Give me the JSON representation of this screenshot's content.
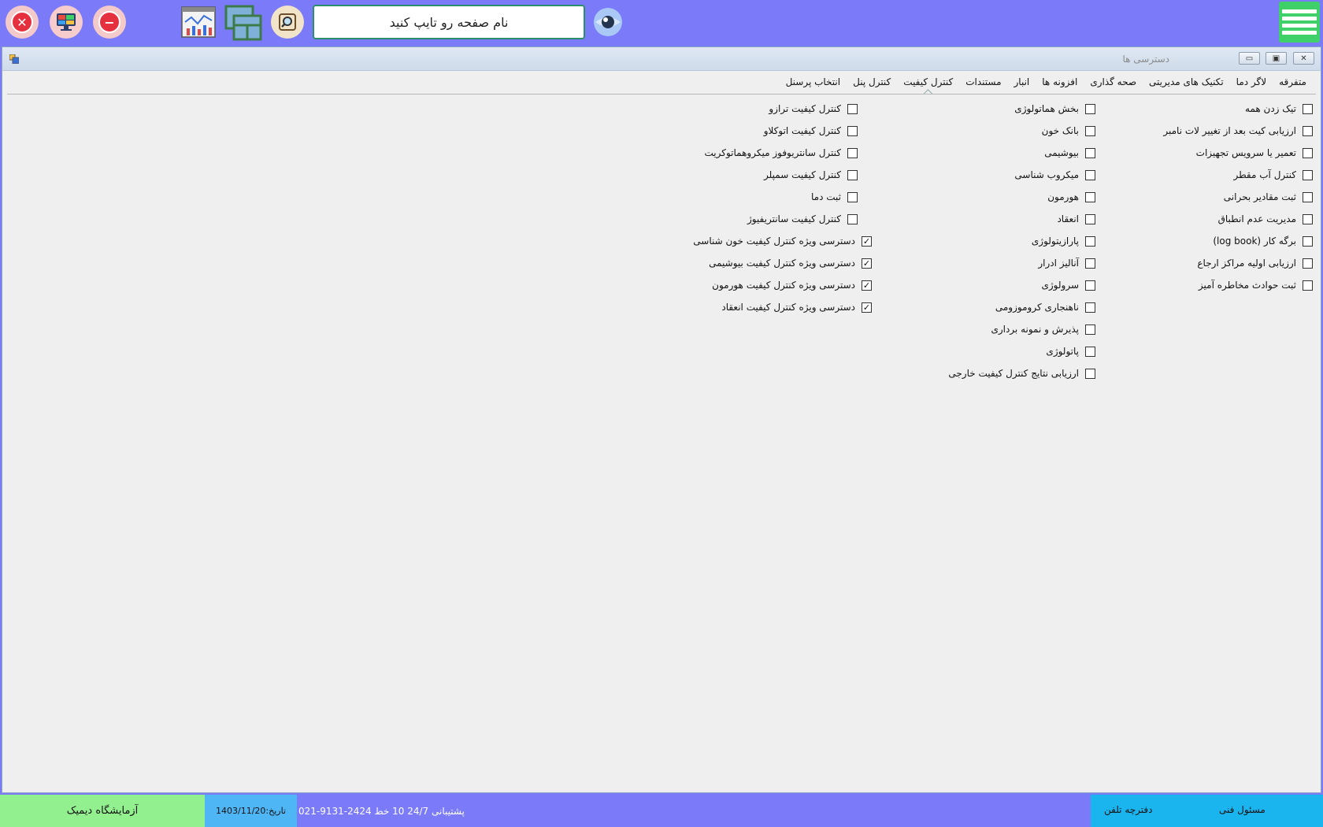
{
  "topbar": {
    "search_placeholder": "نام صفحه رو تایپ کنید"
  },
  "window": {
    "title": "دسترسی ها",
    "min_label": "▭",
    "max_label": "▣",
    "close_label": "✕"
  },
  "tabs": [
    {
      "label": "انتخاب پرسنل"
    },
    {
      "label": "کنترل پنل"
    },
    {
      "label": "کنترل کیفیت",
      "active": true
    },
    {
      "label": "مستندات"
    },
    {
      "label": "انبار"
    },
    {
      "label": "افزونه ها"
    },
    {
      "label": "صحه گذاری"
    },
    {
      "label": "تکنیک های مدیریتی"
    },
    {
      "label": "لاگر دما"
    },
    {
      "label": "متفرقه"
    }
  ],
  "columns": {
    "col1": [
      {
        "label": "تیک زدن همه",
        "checked": false
      },
      {
        "label": "ارزیابی کیت بعد از تغییر لات نامبر",
        "checked": false
      },
      {
        "label": "تعمیر یا سرویس تجهیزات",
        "checked": false
      },
      {
        "label": "کنترل آب مقطر",
        "checked": false
      },
      {
        "label": "ثبت مقادیر بحرانی",
        "checked": false
      },
      {
        "label": "مدیریت عدم انطباق",
        "checked": false
      },
      {
        "label": "برگه کار (log book)",
        "checked": false
      },
      {
        "label": "ارزیابی اولیه مراکز ارجاع",
        "checked": false
      },
      {
        "label": "ثبت حوادث مخاطره آمیز",
        "checked": false
      }
    ],
    "col2": [
      {
        "label": "بخش هماتولوژی",
        "checked": false
      },
      {
        "label": "بانک خون",
        "checked": false
      },
      {
        "label": "بیوشیمی",
        "checked": false
      },
      {
        "label": "میکروب شناسی",
        "checked": false
      },
      {
        "label": "هورمون",
        "checked": false
      },
      {
        "label": "انعقاد",
        "checked": false
      },
      {
        "label": "پارازیتولوژی",
        "checked": false
      },
      {
        "label": "آنالیز ادرار",
        "checked": false
      },
      {
        "label": "سرولوژی",
        "checked": false
      },
      {
        "label": "ناهنجاری کروموزومی",
        "checked": false
      },
      {
        "label": "پذیرش  و نمونه برداری",
        "checked": false
      },
      {
        "label": "پاتولوژی",
        "checked": false
      },
      {
        "label": "ارزیابی نتایج کنترل کیفیت خارجی",
        "checked": false
      }
    ],
    "col3": [
      {
        "label": "کنترل کیفیت ترازو",
        "checked": false
      },
      {
        "label": "کنترل کیفیت اتوکلاو",
        "checked": false
      },
      {
        "label": "کنترل سانتریوفوز میکروهماتوکریت",
        "checked": false
      },
      {
        "label": "کنترل کیفیت سمپلر",
        "checked": false
      },
      {
        "label": "ثبت دما",
        "checked": false
      },
      {
        "label": "کنترل کیفیت سانتریفیوژ",
        "checked": false
      }
    ],
    "col3_special": [
      {
        "label": "دسترسی ویژه کنترل کیفیت خون شناسی",
        "checked": true
      },
      {
        "label": "دسترسی ویژه کنترل کیفیت بیوشیمی",
        "checked": true
      },
      {
        "label": "دسترسی ویژه کنترل کیفیت هورمون",
        "checked": true
      },
      {
        "label": "دسترسی ویژه کنترل کیفیت انعقاد",
        "checked": true
      }
    ]
  },
  "statusbar": {
    "lab_name": "آزمایشگاه دیمیک",
    "date": "تاریخ:1403/11/20",
    "support": "پشتیبانی 24/7   10 خط  2424-9131-021",
    "phonebook": "دفترچه تلفن",
    "tech_manager": "مسئول فنی"
  },
  "colors": {
    "topbar": "#7b7bf9",
    "accent_green": "#3fd06a",
    "status_green": "#93f08f",
    "status_blue": "#4fb6f5",
    "status_cyan": "#1ab5ef"
  }
}
